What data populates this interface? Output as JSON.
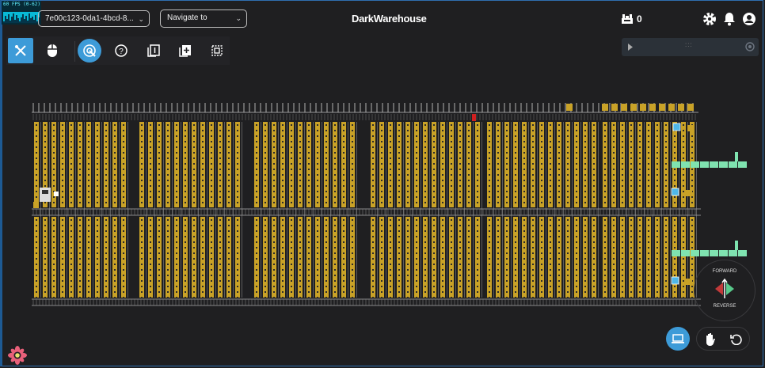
{
  "fps": {
    "label": "60 FPS (0-62)"
  },
  "header": {
    "session_select": "7e00c123-0da1-4bcd-8...",
    "navigate_select": "Navigate to",
    "title": "DarkWarehouse",
    "robot_count": "0"
  },
  "toolbar": {
    "buttons": [
      "tools-icon",
      "mouse-icon",
      "target-icon",
      "help-icon",
      "copy-icon",
      "add-icon",
      "select-area-icon"
    ]
  },
  "panel": {
    "dots": ":::"
  },
  "joystick": {
    "forward": "FORWARD",
    "reverse": "REVERSE"
  },
  "bottom": {
    "buttons": [
      "laptop-icon",
      "hand-icon",
      "reset-icon"
    ]
  },
  "colors": {
    "accent": "#3d9bd8",
    "shelf": "#c9a227",
    "conveyor": "#7fe3b0",
    "robot": "#4fb7e8",
    "alert": "#d02020",
    "background": "#1f1f21"
  }
}
